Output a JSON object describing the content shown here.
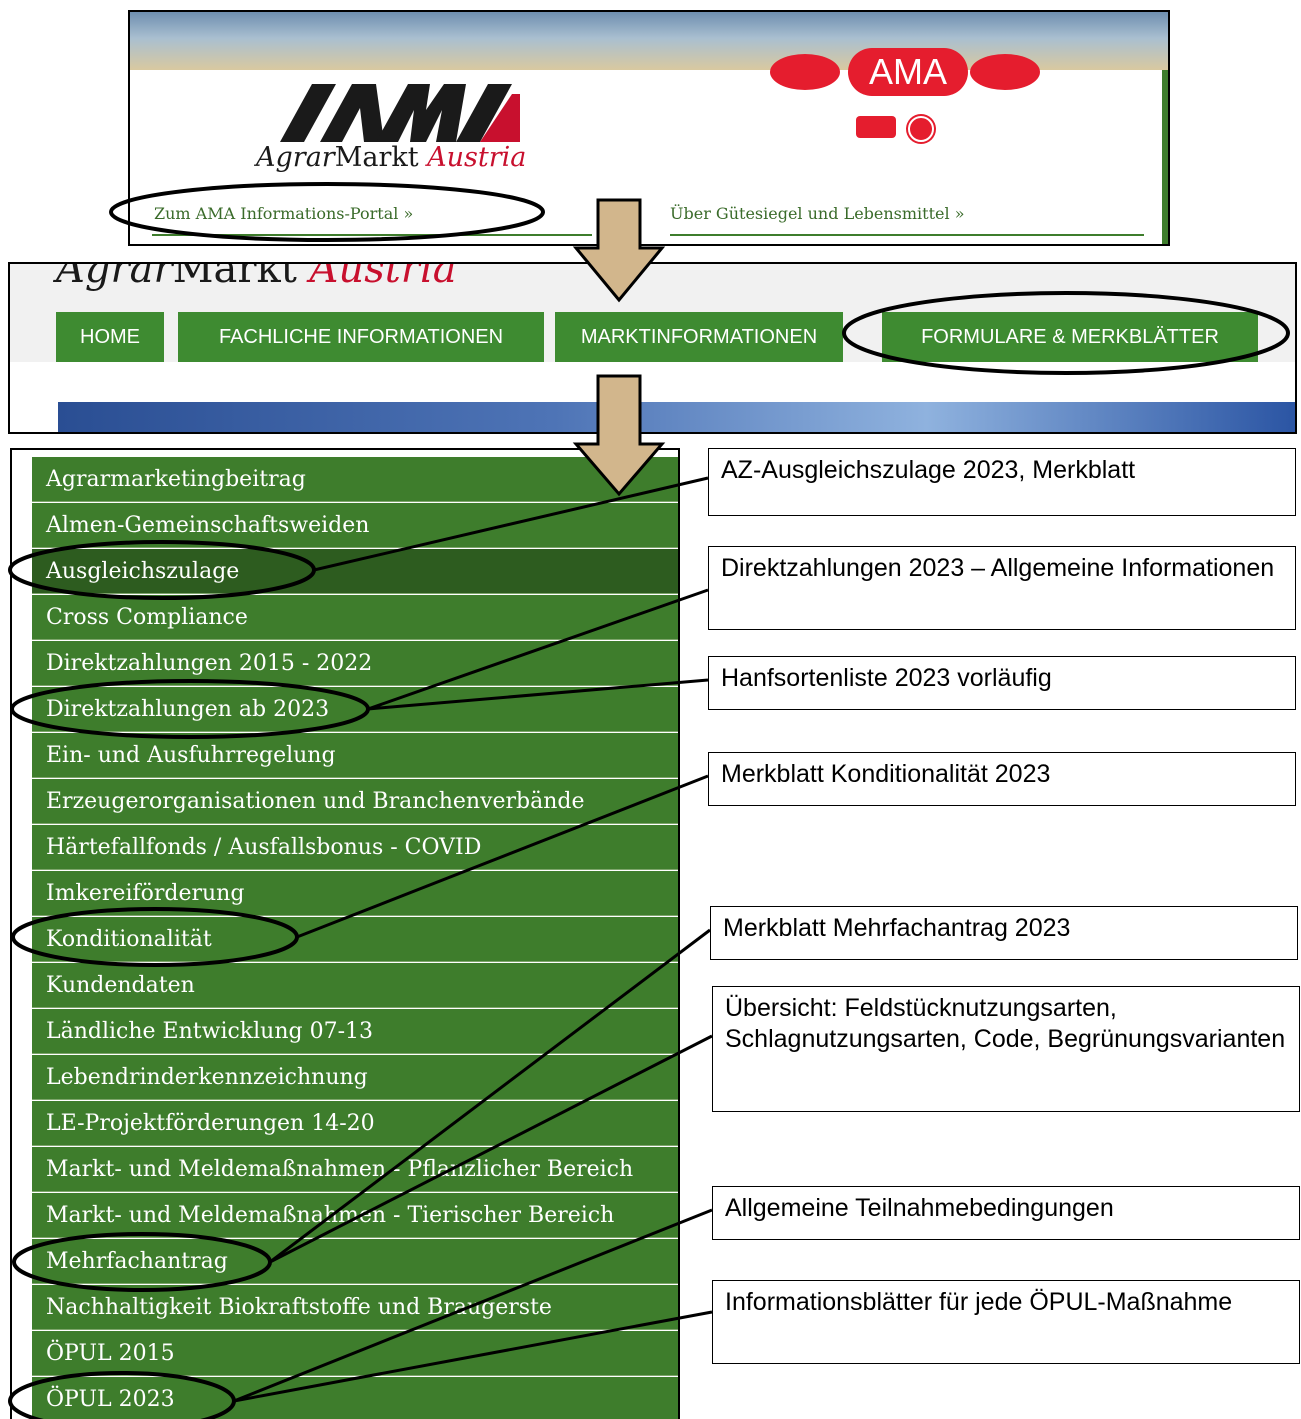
{
  "banner": {
    "agrar_prefix": "Agrar",
    "agrar_middle": "Markt ",
    "agrar_suffix": "Austria",
    "logo_letters": "AMA",
    "seal_label": "AMA",
    "portal_link": "Zum AMA Informations-Portal »",
    "guetesiegel_link": "Über Gütesiegel und Lebensmittel »"
  },
  "header": {
    "title_prefix": "Agrar",
    "title_middle": "Markt ",
    "title_suffix": "Austria"
  },
  "nav": {
    "items": [
      {
        "label": "HOME"
      },
      {
        "label": "FACHLICHE INFORMATIONEN"
      },
      {
        "label": "MARKTINFORMATIONEN"
      },
      {
        "label": "FORMULARE & MERKBLÄTTER"
      }
    ]
  },
  "menu": {
    "items": [
      {
        "label": "Agrarmarketingbeitrag"
      },
      {
        "label": "Almen-Gemeinschaftsweiden"
      },
      {
        "label": "Ausgleichszulage"
      },
      {
        "label": "Cross Compliance"
      },
      {
        "label": "Direktzahlungen 2015 - 2022"
      },
      {
        "label": "Direktzahlungen ab 2023"
      },
      {
        "label": "Ein- und Ausfuhrregelung"
      },
      {
        "label": "Erzeugerorganisationen und Branchenverbände"
      },
      {
        "label": "Härtefallfonds / Ausfallsbonus - COVID"
      },
      {
        "label": "Imkereiförderung"
      },
      {
        "label": "Konditionalität"
      },
      {
        "label": "Kundendaten"
      },
      {
        "label": "Ländliche Entwicklung 07-13"
      },
      {
        "label": "Lebendrinderkennzeichnung"
      },
      {
        "label": "LE-Projektförderungen 14-20"
      },
      {
        "label": "Markt- und Meldemaßnahmen - Pflanzlicher Bereich"
      },
      {
        "label": "Markt- und Meldemaßnahmen - Tierischer Bereich"
      },
      {
        "label": "Mehrfachantrag"
      },
      {
        "label": "Nachhaltigkeit Biokraftstoffe und Braugerste"
      },
      {
        "label": "ÖPUL 2015"
      },
      {
        "label": "ÖPUL 2023"
      }
    ],
    "active_index": 2
  },
  "callouts": [
    {
      "text": "AZ-Ausgleichszulage 2023, Merkblatt"
    },
    {
      "text": "Direktzahlungen 2023 – Allgemeine Informationen"
    },
    {
      "text": "Hanfsortenliste 2023 vorläufig"
    },
    {
      "text": "Merkblatt Konditionalität 2023"
    },
    {
      "text": "Merkblatt Mehrfachantrag 2023"
    },
    {
      "text": "Übersicht: Feldstücknutzungsarten, Schlagnutzungsarten, Code, Begrünungsvarianten"
    },
    {
      "text": "Allgemeine Teilnahmebedingungen"
    },
    {
      "text": "Informationsblätter für jede ÖPUL-Maßnahme"
    }
  ],
  "colors": {
    "menu_green": "#3e7d2c",
    "menu_active": "#2d5c1f",
    "nav_green": "#3e8b31",
    "arrow_fill": "#d2b68c",
    "brand_red": "#c8102e"
  }
}
